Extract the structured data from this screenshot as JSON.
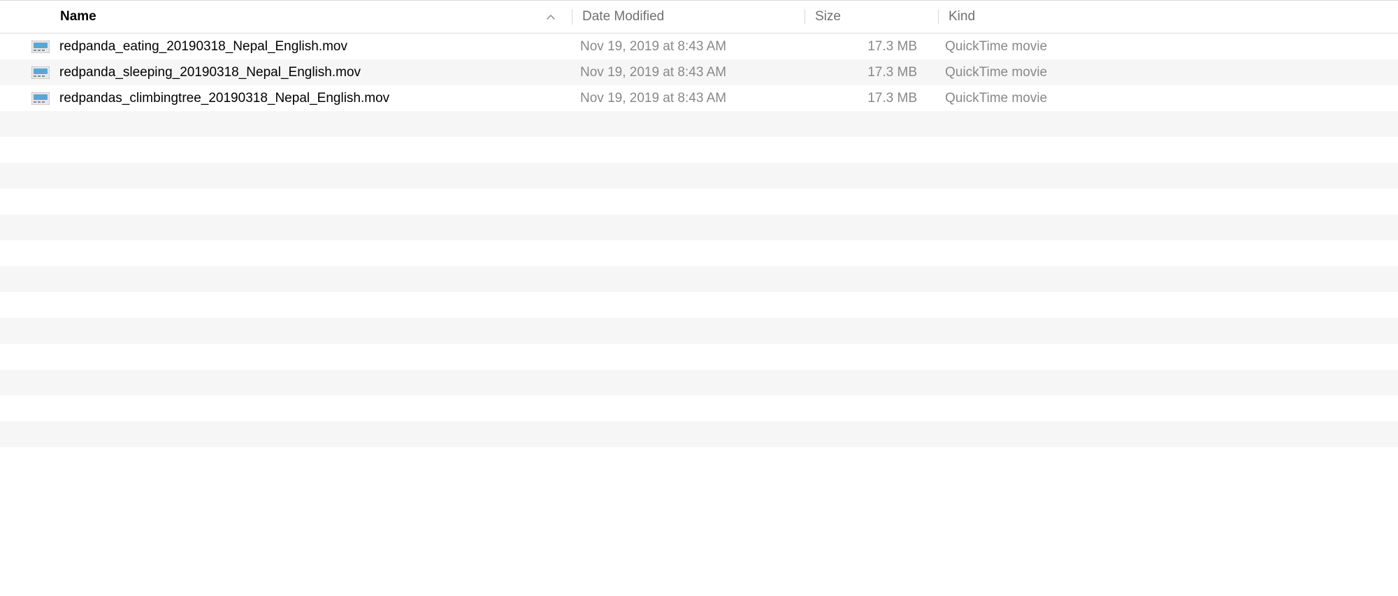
{
  "columns": {
    "name": "Name",
    "date": "Date Modified",
    "size": "Size",
    "kind": "Kind"
  },
  "files": [
    {
      "name": "redpanda_eating_20190318_Nepal_English.mov",
      "date": "Nov 19, 2019 at 8:43 AM",
      "size": "17.3 MB",
      "kind": "QuickTime movie"
    },
    {
      "name": "redpanda_sleeping_20190318_Nepal_English.mov",
      "date": "Nov 19, 2019 at 8:43 AM",
      "size": "17.3 MB",
      "kind": "QuickTime movie"
    },
    {
      "name": "redpandas_climbingtree_20190318_Nepal_English.mov",
      "date": "Nov 19, 2019 at 8:43 AM",
      "size": "17.3 MB",
      "kind": "QuickTime movie"
    }
  ]
}
